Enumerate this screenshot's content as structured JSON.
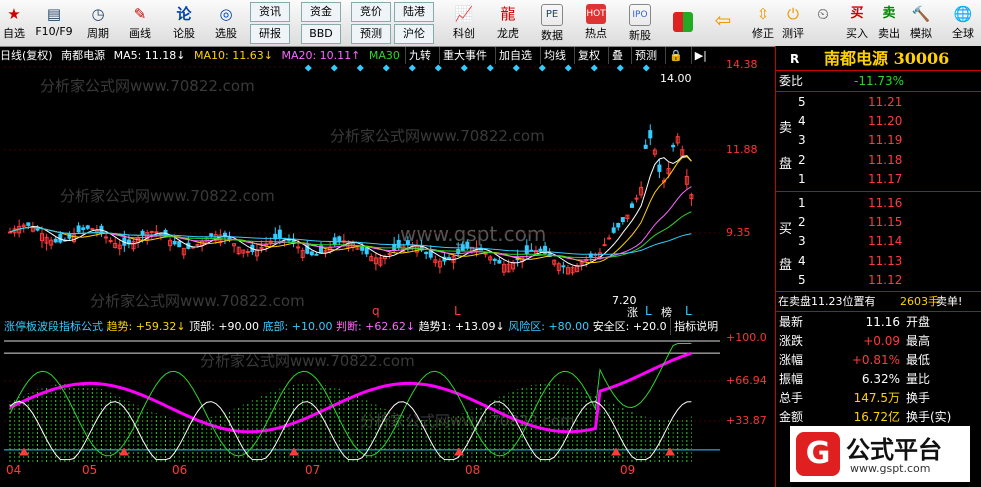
{
  "toolbar": {
    "items": [
      {
        "label": "自选",
        "icon": "star-icon"
      },
      {
        "label": "F10/F9",
        "icon": "f10-icon"
      },
      {
        "label": "周期",
        "icon": "period-icon"
      },
      {
        "label": "画线",
        "icon": "pen-icon"
      },
      {
        "label": "论股",
        "icon": "discuss-icon"
      },
      {
        "label": "选股",
        "icon": "select-icon"
      }
    ],
    "mini_buttons": [
      "资讯",
      "资金",
      "竞价",
      "陆港",
      "研报",
      "BBD",
      "预测",
      "沪伦"
    ],
    "right_items": [
      {
        "label": "科创",
        "icon": "chart-icon"
      },
      {
        "label": "龙虎",
        "icon": "dragon-icon"
      },
      {
        "label": "数据",
        "icon": "pe-icon"
      },
      {
        "label": "热点",
        "icon": "hot-icon"
      },
      {
        "label": "新股",
        "icon": "ipo-icon"
      },
      {
        "label": "",
        "icon": "grid-icon"
      },
      {
        "label": "",
        "icon": "back-arrow-icon"
      },
      {
        "label": "修正",
        "icon": "fix-icon"
      },
      {
        "label": "测评",
        "icon": "clock-icon"
      },
      {
        "label": "买入",
        "icon": "buy-icon"
      },
      {
        "label": "卖出",
        "icon": "sell-icon"
      },
      {
        "label": "模拟",
        "icon": "hammer-icon"
      },
      {
        "label": "全球",
        "icon": "globe-icon"
      }
    ]
  },
  "chart_header": {
    "period": "日线(复权)",
    "stock_name": "南都电源",
    "ma5": "MA5: 11.18↓",
    "ma10": "MA10: 11.63↓",
    "ma20": "MA20: 10.11↑",
    "ma30": "MA30",
    "buttons": [
      "九转",
      "重大事件",
      "加自选",
      "均线",
      "复权",
      "叠",
      "预测"
    ]
  },
  "price_axis": [
    "14.38",
    "11.88",
    "9.35"
  ],
  "annotations": {
    "high": "14.00",
    "low": "7.20",
    "marks": [
      "q",
      "L",
      "涨",
      "L",
      "榜",
      "L"
    ]
  },
  "indicator_header": {
    "name": "涨停板波段指标公式",
    "trend": "趋势: +59.32↓",
    "top": "顶部: +90.00",
    "bottom": "底部: +10.00",
    "judge": "判断: +62.62↓",
    "trend1": "趋势1: +13.09↓",
    "risk": "风险区: +80.00",
    "safe": "安全区: +20.0",
    "help": "指标说明"
  },
  "indicator_axis": [
    "+100.0",
    "+66.94",
    "+33.87"
  ],
  "dates": [
    "04",
    "05",
    "06",
    "07",
    "08",
    "09"
  ],
  "watermark": [
    "分析家公式网www.70822.com",
    "www.gspt.com"
  ],
  "right_panel": {
    "r_label": "R",
    "title": "南都电源 30006",
    "weibi_label": "委比",
    "weibi_value": "-11.73%",
    "sell_label": [
      "卖",
      "盘"
    ],
    "buy_label": [
      "买",
      "盘"
    ],
    "sell": [
      {
        "n": "5",
        "price": "11.21"
      },
      {
        "n": "4",
        "price": "11.20"
      },
      {
        "n": "3",
        "price": "11.19"
      },
      {
        "n": "2",
        "price": "11.18"
      },
      {
        "n": "1",
        "price": "11.17"
      }
    ],
    "buy": [
      {
        "n": "1",
        "price": "11.16"
      },
      {
        "n": "2",
        "price": "11.15"
      },
      {
        "n": "3",
        "price": "11.14"
      },
      {
        "n": "4",
        "price": "11.13"
      },
      {
        "n": "5",
        "price": "11.12"
      }
    ],
    "sell_order": "在卖盘11.23位置有",
    "sell_order_qty": "2603手",
    "sell_order_tail": "卖单!",
    "quotes": [
      {
        "l": "最新",
        "v": "11.16",
        "r": "开盘"
      },
      {
        "l": "涨跌",
        "v": "+0.09",
        "r": "最高"
      },
      {
        "l": "涨幅",
        "v": "+0.81%",
        "r": "最低"
      },
      {
        "l": "振幅",
        "v": "6.32%",
        "r": "量比"
      },
      {
        "l": "总手",
        "v": "147.5万",
        "r": "换手"
      },
      {
        "l": "金额",
        "v": "16.72亿",
        "r": "换手(实)"
      }
    ],
    "logo_text": "公式平台",
    "logo_url": "www.gspt.com"
  },
  "colors": {
    "red": "#ff3b3b",
    "green": "#2bd52b",
    "yellow": "#ffd200",
    "magenta": "#ff00ff",
    "cyan": "#3cf"
  }
}
